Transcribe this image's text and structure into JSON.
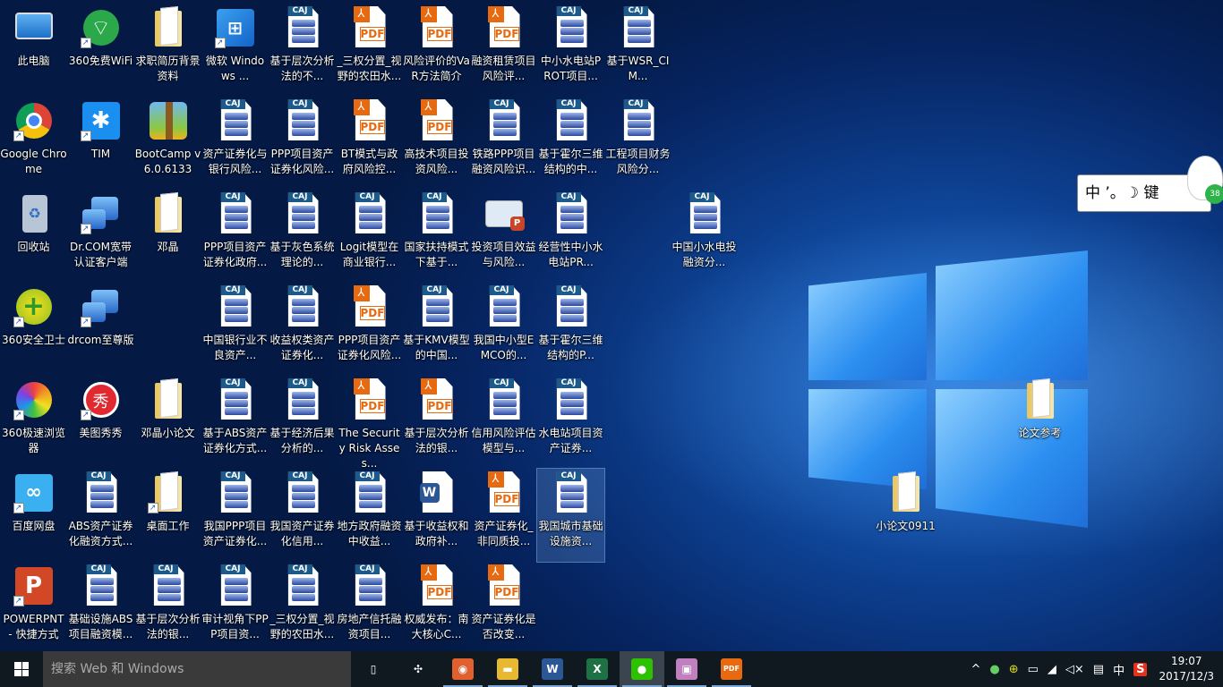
{
  "desktop": {
    "rows": [
      [
        {
          "label": "此电脑",
          "type": "pc"
        },
        {
          "label": "360免费WiFi",
          "type": "wifi",
          "shortcut": true
        },
        {
          "label": "求职简历背景资料",
          "type": "folder"
        },
        {
          "label": "微软 Windows ...",
          "type": "windows",
          "shortcut": true
        },
        {
          "label": "基于层次分析法的不...",
          "type": "caj"
        },
        {
          "label": "_三权分置_视野的农田水...",
          "type": "pdf"
        },
        {
          "label": "风险评价的VaR方法简介",
          "type": "pdf"
        },
        {
          "label": "融资租赁项目风险评...",
          "type": "pdf"
        },
        {
          "label": "中小水电站PROT项目...",
          "type": "caj"
        },
        {
          "label": "基于WSR_CIM...",
          "type": "caj"
        }
      ],
      [
        {
          "label": "Google Chrome",
          "type": "chrome",
          "shortcut": true
        },
        {
          "label": "TIM",
          "type": "tim",
          "shortcut": true
        },
        {
          "label": "BootCamp v6.0.6133",
          "type": "bootcamp"
        },
        {
          "label": "资产证券化与银行风险...",
          "type": "caj"
        },
        {
          "label": "PPP项目资产证券化风险...",
          "type": "caj"
        },
        {
          "label": "BT模式与政府风险控...",
          "type": "pdf"
        },
        {
          "label": "高技术项目投资风险...",
          "type": "pdf"
        },
        {
          "label": "铁路PPP项目融资风险识...",
          "type": "caj"
        },
        {
          "label": "基于霍尔三维结构的中...",
          "type": "caj"
        },
        {
          "label": "工程项目财务风险分...",
          "type": "caj"
        }
      ],
      [
        {
          "label": "回收站",
          "type": "recycle"
        },
        {
          "label": "Dr.COM宽带认证客户端",
          "type": "drcom",
          "shortcut": true
        },
        {
          "label": "邓晶",
          "type": "folder"
        },
        {
          "label": "PPP项目资产证券化政府...",
          "type": "caj"
        },
        {
          "label": "基于灰色系统理论的...",
          "type": "caj"
        },
        {
          "label": "Logit模型在商业银行...",
          "type": "caj"
        },
        {
          "label": "国家扶持模式下基于...",
          "type": "caj"
        },
        {
          "label": "投资项目效益与风险...",
          "type": "ppt-image"
        },
        {
          "label": "经营性中小水电站PR...",
          "type": "caj"
        }
      ],
      [
        {
          "label": "360安全卫士",
          "type": "360safe",
          "shortcut": true
        },
        {
          "label": "drcom至尊版",
          "type": "drcom",
          "shortcut": true
        },
        null,
        {
          "label": "中国银行业不良资产...",
          "type": "caj"
        },
        {
          "label": "收益权类资产证券化...",
          "type": "caj"
        },
        {
          "label": "PPP项目资产证券化风险...",
          "type": "pdf"
        },
        {
          "label": "基于KMV模型的中国...",
          "type": "caj"
        },
        {
          "label": "我国中小型EMCO的...",
          "type": "caj"
        },
        {
          "label": "基于霍尔三维结构的P...",
          "type": "caj"
        }
      ],
      [
        {
          "label": "360极速浏览器",
          "type": "360browser",
          "shortcut": true
        },
        {
          "label": "美图秀秀",
          "type": "meitu",
          "shortcut": true
        },
        {
          "label": "邓晶小论文",
          "type": "folder"
        },
        {
          "label": "基于ABS资产证券化方式...",
          "type": "caj"
        },
        {
          "label": "基于经济后果分析的...",
          "type": "caj"
        },
        {
          "label": "The Security Risk Asses...",
          "type": "pdf"
        },
        {
          "label": "基于层次分析法的银...",
          "type": "pdf"
        },
        {
          "label": "信用风险评估模型与...",
          "type": "caj"
        },
        {
          "label": "水电站项目资产证券...",
          "type": "caj"
        }
      ],
      [
        {
          "label": "百度网盘",
          "type": "baidu",
          "shortcut": true
        },
        {
          "label": "ABS资产证券化融资方式...",
          "type": "caj"
        },
        {
          "label": "桌面工作",
          "type": "folder",
          "shortcut": true
        },
        {
          "label": "我国PPP项目资产证券化...",
          "type": "caj"
        },
        {
          "label": "我国资产证券化信用...",
          "type": "caj"
        },
        {
          "label": "地方政府融资中收益...",
          "type": "caj"
        },
        {
          "label": "基于收益权和政府补...",
          "type": "word"
        },
        {
          "label": "资产证券化_非同质投...",
          "type": "pdf"
        },
        {
          "label": "我国城市基础设施资...",
          "type": "caj",
          "selected": true
        }
      ],
      [
        {
          "label": "POWERPNT - 快捷方式",
          "type": "ppt",
          "shortcut": true
        },
        {
          "label": "基础设施ABS项目融资模...",
          "type": "caj"
        },
        {
          "label": "基于层次分析法的银...",
          "type": "caj"
        },
        {
          "label": "审计视角下PPP项目资...",
          "type": "caj"
        },
        {
          "label": "_三权分置_视野的农田水...",
          "type": "caj"
        },
        {
          "label": "房地产信托融资项目...",
          "type": "caj"
        },
        {
          "label": "权威发布：南大核心C...",
          "type": "pdf"
        },
        {
          "label": "资产证券化是否改变...",
          "type": "pdf"
        }
      ]
    ],
    "extra_icons": [
      {
        "label": "中国小水电投融资分...",
        "type": "caj"
      },
      {
        "label": "论文参考",
        "type": "folder"
      },
      {
        "label": "小论文0911",
        "type": "folder"
      }
    ]
  },
  "ime": {
    "text": "中 ’。☽ 键",
    "badge": "38"
  },
  "taskbar": {
    "search_placeholder": "搜索 Web 和 Windows",
    "apps": [
      {
        "name": "task-view",
        "glyph": "▯"
      },
      {
        "name": "fan-app",
        "glyph": "✣"
      },
      {
        "name": "360-browser",
        "glyph": "◉"
      },
      {
        "name": "file-explorer",
        "glyph": "▬"
      },
      {
        "name": "word",
        "glyph": "W"
      },
      {
        "name": "excel",
        "glyph": "X"
      },
      {
        "name": "wechat",
        "glyph": "●"
      },
      {
        "name": "image-app",
        "glyph": "▣"
      },
      {
        "name": "pdf-reader",
        "glyph": "PDF"
      }
    ],
    "tray": {
      "chevron": "^",
      "ime_lang": "中",
      "date": "2017/12/3",
      "time": "19:07"
    }
  }
}
